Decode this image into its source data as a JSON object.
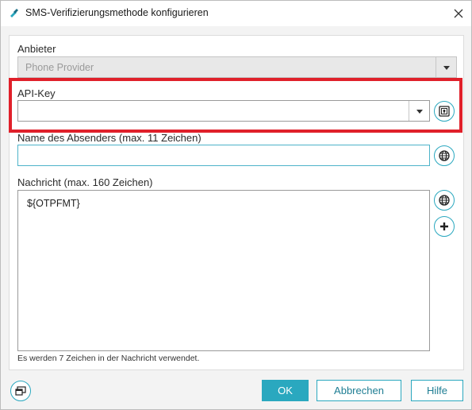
{
  "window": {
    "title": "SMS-Verifizierungsmethode konfigurieren"
  },
  "form": {
    "provider": {
      "label": "Anbieter",
      "value": "Phone Provider"
    },
    "api_key": {
      "label": "API-Key",
      "value": ""
    },
    "sender_name": {
      "label": "Name des Absenders (max. 11 Zeichen)",
      "value": ""
    },
    "message": {
      "label": "Nachricht (max. 160 Zeichen)",
      "value": "${OTPFMT}"
    },
    "hint": "Es werden 7 Zeichen in der Nachricht verwendet."
  },
  "buttons": {
    "ok": "OK",
    "cancel": "Abbrechen",
    "help": "Hilfe"
  },
  "icons": {
    "app": "app-logo-icon",
    "close": "close-icon",
    "api_key_picker": "key-vault-icon",
    "sender_globe": "globe-icon",
    "message_globe": "globe-icon",
    "message_add": "plus-icon",
    "footer": "window-icon"
  },
  "colors": {
    "accent": "#2aa8bf",
    "highlight": "#e0202a"
  }
}
